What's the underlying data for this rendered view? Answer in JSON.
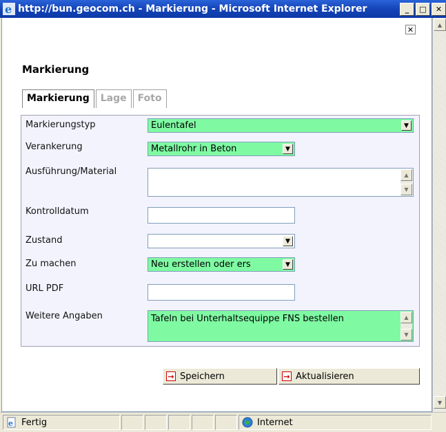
{
  "window": {
    "title": "http://bun.geocom.ch - Markierung - Microsoft Internet Explorer",
    "minimize_label": "_",
    "maximize_label": "□",
    "close_label": "✕"
  },
  "dialog": {
    "close_label": "✕",
    "heading": "Markierung"
  },
  "tabs": [
    {
      "label": "Markierung",
      "active": true
    },
    {
      "label": "Lage",
      "active": false
    },
    {
      "label": "Foto",
      "active": false
    }
  ],
  "form": {
    "markierungstyp": {
      "label": "Markierungstyp",
      "value": "Eulentafel"
    },
    "verankerung": {
      "label": "Verankerung",
      "value": "Metallrohr in Beton"
    },
    "ausfuehrung": {
      "label": "Ausführung/Material",
      "value": ""
    },
    "kontrolldatum": {
      "label": "Kontrolldatum",
      "value": ""
    },
    "zustand": {
      "label": "Zustand",
      "value": ""
    },
    "zu_machen": {
      "label": "Zu machen",
      "value": "Neu erstellen oder ers"
    },
    "url_pdf": {
      "label": "URL PDF",
      "value": ""
    },
    "weitere_angaben": {
      "label": "Weitere Angaben",
      "value": "Tafeln bei Unterhaltsequippe FNS bestellen"
    }
  },
  "buttons": {
    "save": "Speichern",
    "refresh": "Aktualisieren"
  },
  "statusbar": {
    "status": "Fertig",
    "zone": "Internet"
  },
  "colors": {
    "field_highlight": "#7ffaa3",
    "panel_bg": "#f3f3fe",
    "titlebar": "#1544b8"
  }
}
